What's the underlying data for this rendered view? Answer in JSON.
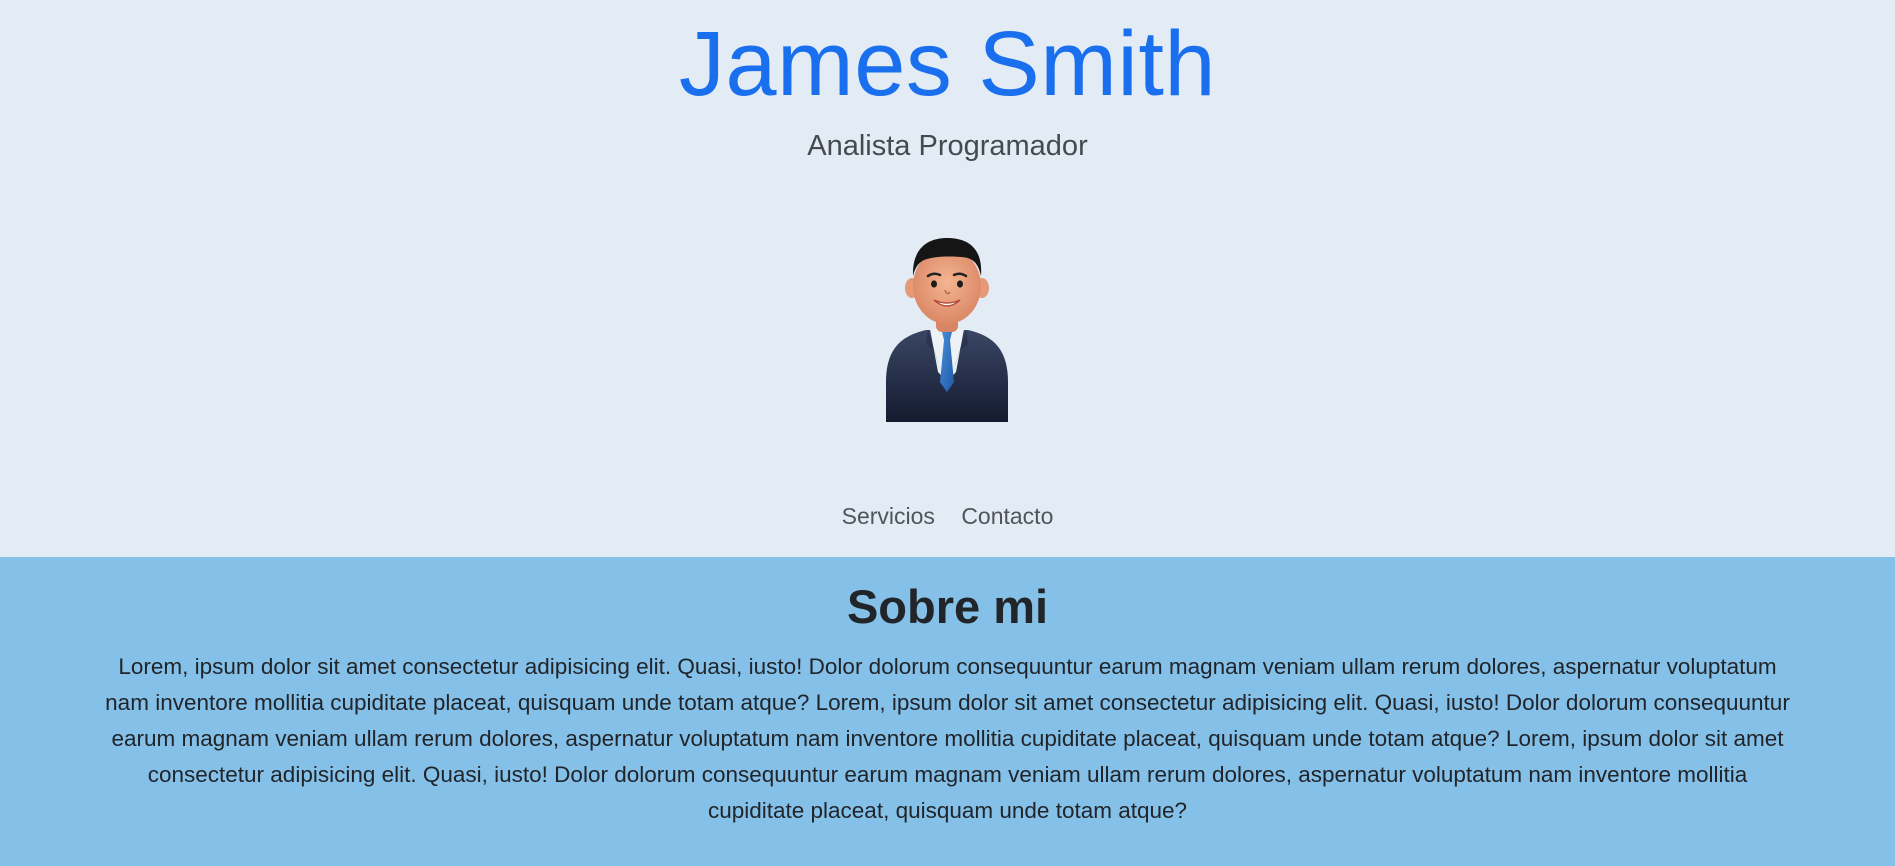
{
  "header": {
    "name": "James Smith",
    "role": "Analista Programador",
    "name_color": "#1a6fef",
    "background": "#e3ebf5"
  },
  "avatar": {
    "icon": "businessman-avatar-icon"
  },
  "nav": {
    "items": [
      {
        "label": "Servicios"
      },
      {
        "label": "Contacto"
      }
    ]
  },
  "about": {
    "title": "Sobre mi",
    "text": "Lorem, ipsum dolor sit amet consectetur adipisicing elit. Quasi, iusto! Dolor dolorum consequuntur earum magnam veniam ullam rerum dolores, aspernatur voluptatum nam inventore mollitia cupiditate placeat, quisquam unde totam atque? Lorem, ipsum dolor sit amet consectetur adipisicing elit. Quasi, iusto! Dolor dolorum consequuntur earum magnam veniam ullam rerum dolores, aspernatur voluptatum nam inventore mollitia cupiditate placeat, quisquam unde totam atque? Lorem, ipsum dolor sit amet consectetur adipisicing elit. Quasi, iusto! Dolor dolorum consequuntur earum magnam veniam ullam rerum dolores, aspernatur voluptatum nam inventore mollitia cupiditate placeat, quisquam unde totam atque?",
    "background": "#85c0e9"
  }
}
